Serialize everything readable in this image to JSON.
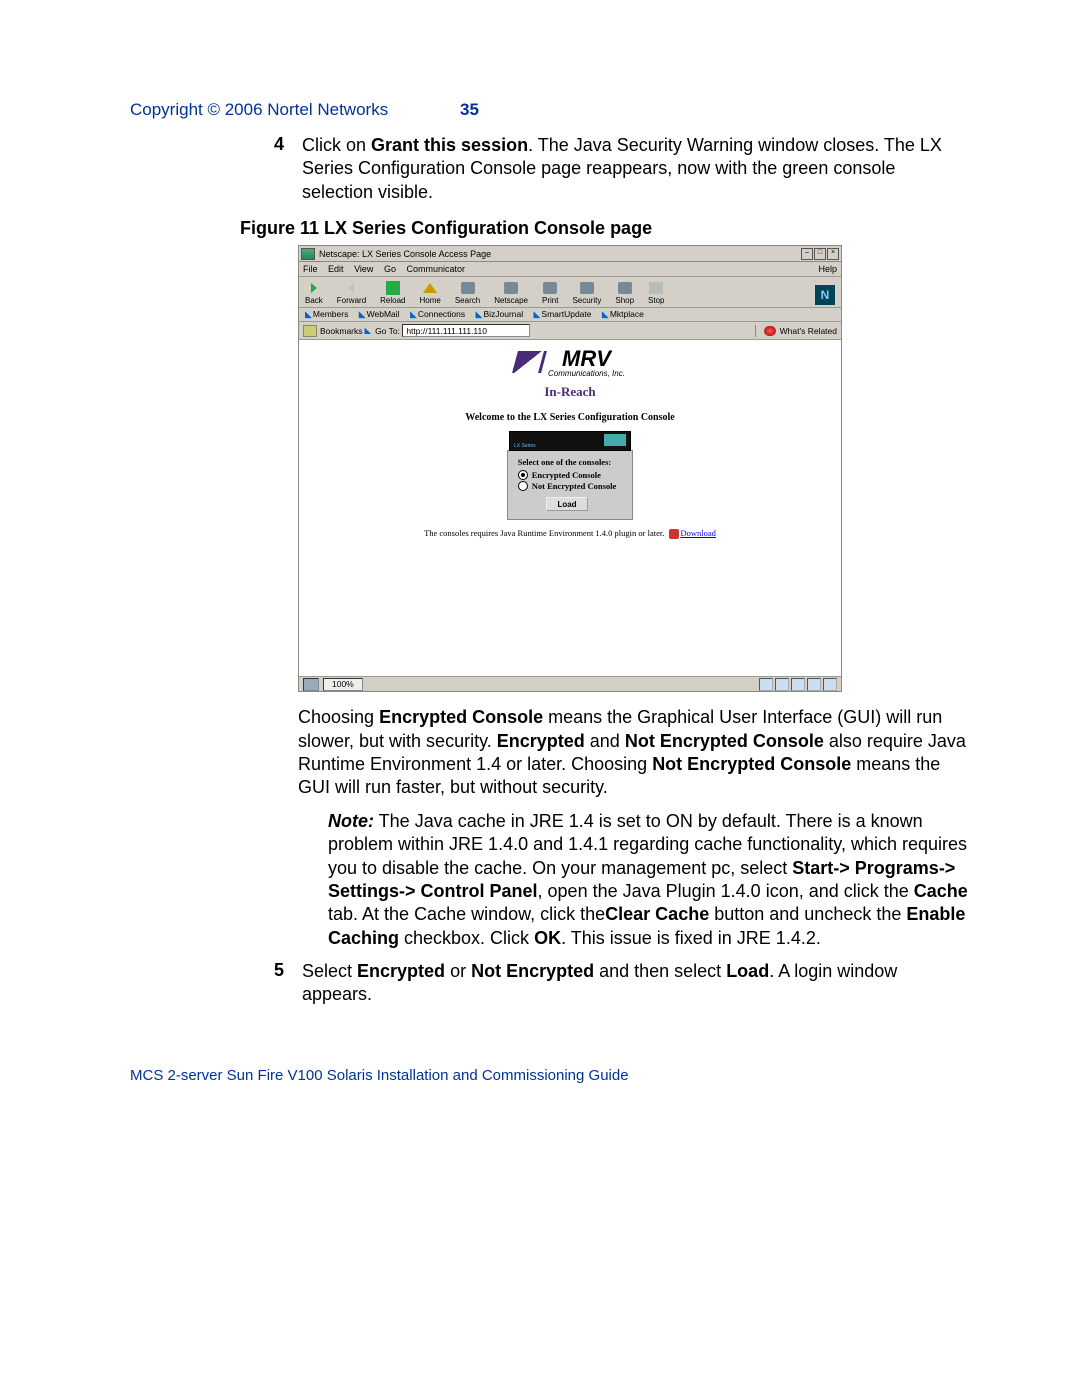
{
  "header": {
    "copyright": "Copyright © 2006 Nortel Networks",
    "page_number": "35"
  },
  "step4": {
    "num": "4",
    "t1": "Click on ",
    "b1": "Grant this session",
    "t2": ". The Java Security Warning window closes. The LX Series Configuration Console page reappears, now with the green console selection visible."
  },
  "figure_caption": "Figure 11  LX Series Configuration Console page",
  "browser": {
    "title": "Netscape: LX Series Console Access Page",
    "menu": {
      "file": "File",
      "edit": "Edit",
      "view": "View",
      "go": "Go",
      "comm": "Communicator",
      "help": "Help"
    },
    "toolbar": {
      "back": "Back",
      "forward": "Forward",
      "reload": "Reload",
      "home": "Home",
      "search": "Search",
      "netscape": "Netscape",
      "print": "Print",
      "security": "Security",
      "shop": "Shop",
      "stop": "Stop",
      "logo": "N"
    },
    "linkbar": {
      "a": "Members",
      "b": "WebMail",
      "c": "Connections",
      "d": "BizJournal",
      "e": "SmartUpdate",
      "f": "Mktplace"
    },
    "location": {
      "bookmarks": "Bookmarks",
      "goto": "Go To:",
      "url": "http://111.111.111.110",
      "related": "What's Related"
    },
    "page": {
      "mrv": "MRV",
      "mrv_sub": "Communications, Inc.",
      "inreach": "In-Reach",
      "welcome": "Welcome to the LX Series Configuration Console",
      "select_title": "Select one of the consoles:",
      "opt1": "Encrypted Console",
      "opt2": "Not Encrypted Console",
      "load": "Load",
      "requires": "The consoles requires Java Runtime Environment 1.4.0 plugin or later. ",
      "download": "Download"
    },
    "status": {
      "percent": "100%"
    }
  },
  "para1": {
    "t1": "Choosing ",
    "b1": "Encrypted Console",
    "t2": " means the Graphical User Interface (GUI) will run slower, but with security. ",
    "b2": "Encrypted",
    "t3": " and ",
    "b3": "Not Encrypted Console",
    "t4": " also require Java Runtime Environment 1.4 or later. Choosing ",
    "b4": "Not Encrypted Console",
    "t5": " means the GUI will run faster, but without security."
  },
  "note": {
    "label": "Note:",
    "t1": "  The Java cache in JRE 1.4 is set to ON by default. There is a known problem within JRE 1.4.0 and 1.4.1 regarding cache functionality, which requires you to disable the cache. On your management pc, select ",
    "b1": "Start-> Programs-> Settings-> Control Panel",
    "t2": ", open the Java Plugin 1.4.0 icon, and click the ",
    "b2": "Cache",
    "t3": " tab. At the Cache window, click the",
    "b3": "Clear Cache",
    "t4": " button and uncheck the ",
    "b4": "Enable Caching",
    "t5": " checkbox. Click ",
    "b5": "OK",
    "t6": ". This issue is fixed in JRE 1.4.2."
  },
  "step5": {
    "num": "5",
    "t1": "Select ",
    "b1": "Encrypted",
    "t2": " or ",
    "b2": "Not Encrypted",
    "t3": " and then select ",
    "b3": "Load",
    "t4": ". A login window appears."
  },
  "footer": "MCS 2-server Sun Fire V100 Solaris Installation and Commissioning Guide"
}
